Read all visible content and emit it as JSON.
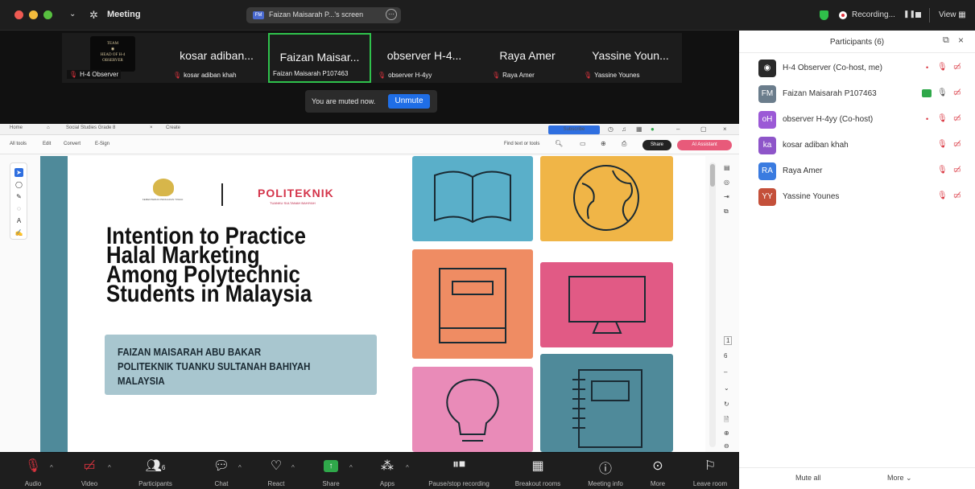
{
  "window": {
    "title": "Meeting",
    "screen_pill": "Faizan Maisarah P...'s screen",
    "recording_label": "Recording...",
    "view_label": "View",
    "colors": {
      "traffic_red": "#ee5a52",
      "traffic_yellow": "#f3bb3c",
      "traffic_green": "#58c140",
      "active_speaker": "#2fc24c",
      "unmute_button": "#1f6ee6"
    }
  },
  "thumbnails": [
    {
      "name": "",
      "label": "H-4 Observer",
      "logo_text": "TEAM\nHEAD OF OBSERVER"
    },
    {
      "name": "kosar adiban...",
      "label": "kosar adiban khah"
    },
    {
      "name": "Faizan Maisar...",
      "label": "Faizan Maisarah P107463",
      "active": true
    },
    {
      "name": "observer H-4...",
      "label": "observer H-4yy"
    },
    {
      "name": "Raya Amer",
      "label": "Raya Amer"
    },
    {
      "name": "Yassine Youn...",
      "label": "Yassine Younes"
    }
  ],
  "toast": {
    "text": "You are muted now.",
    "button": "Unmute"
  },
  "pdf": {
    "tabs": [
      "Home",
      "Social Studies Grade 8",
      "Create"
    ],
    "subscribe": "Subscribe",
    "menu": [
      "All tools",
      "Edit",
      "Convert",
      "E-Sign"
    ],
    "find": "Find text or tools",
    "share": "Share",
    "ai": "AI Assistant"
  },
  "slide": {
    "agency": "KEMENTERIAN PENGAJIAN TINGGI",
    "brand": "POLITEKNIK",
    "brand_sub": "TUANKU SULTANAH BAHIYAH",
    "title_lines": [
      "Intention to Practice",
      "Halal Marketing",
      "Among Polytechnic",
      "Students in Malaysia"
    ],
    "author_lines": [
      "FAIZAN MAISARAH ABU BAKAR",
      "POLITEKNIK TUANKU SULTANAH BAHIYAH",
      "MALAYSIA"
    ]
  },
  "panel": {
    "title": "Participants (6)",
    "participants": [
      {
        "initials": "",
        "name": "H-4 Observer (Co-host, me)",
        "color": "#2a2a2a"
      },
      {
        "initials": "FM",
        "name": "Faizan Maisarah P107463",
        "color": "#6b7d8c"
      },
      {
        "initials": "oH",
        "name": "observer H-4yy (Co-host)",
        "color": "#9b59d6"
      },
      {
        "initials": "ka",
        "name": "kosar adiban khah",
        "color": "#8e55c9"
      },
      {
        "initials": "RA",
        "name": "Raya Amer",
        "color": "#3a7be0"
      },
      {
        "initials": "YY",
        "name": "Yassine Younes",
        "color": "#c4503a"
      }
    ],
    "mute_all": "Mute all",
    "more": "More"
  },
  "toolbar": [
    {
      "icon": "mic-muted-icon",
      "label": "Audio"
    },
    {
      "icon": "video-off-icon",
      "label": "Video"
    },
    {
      "icon": "participants-icon",
      "label": "Participants",
      "count": "6"
    },
    {
      "icon": "chat-icon",
      "label": "Chat"
    },
    {
      "icon": "react-icon",
      "label": "React"
    },
    {
      "icon": "share-icon",
      "label": "Share"
    },
    {
      "icon": "apps-icon",
      "label": "Apps"
    },
    {
      "icon": "record-icon",
      "label": "Pause/stop recording"
    },
    {
      "icon": "breakout-icon",
      "label": "Breakout rooms"
    },
    {
      "icon": "info-icon",
      "label": "Meeting info"
    },
    {
      "icon": "more-icon",
      "label": "More"
    },
    {
      "icon": "leave-icon",
      "label": "Leave room"
    }
  ]
}
